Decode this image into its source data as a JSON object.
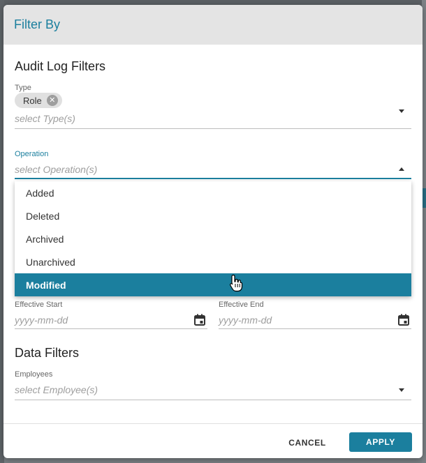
{
  "modal": {
    "title": "Filter By"
  },
  "audit": {
    "section_title": "Audit Log Filters",
    "type": {
      "label": "Type",
      "chip": "Role",
      "placeholder": "select Type(s)"
    },
    "operation": {
      "label": "Operation",
      "placeholder": "select Operation(s)",
      "options": [
        "Added",
        "Deleted",
        "Archived",
        "Unarchived",
        "Modified"
      ],
      "highlighted": "Modified"
    },
    "effective_start": {
      "label": "Effective Start",
      "placeholder": "yyyy-mm-dd"
    },
    "effective_end": {
      "label": "Effective End",
      "placeholder": "yyyy-mm-dd"
    }
  },
  "data_filters": {
    "section_title": "Data Filters",
    "employees": {
      "label": "Employees",
      "placeholder": "select Employee(s)"
    }
  },
  "footer": {
    "cancel": "CANCEL",
    "apply": "APPLY"
  },
  "colors": {
    "accent": "#1b7f9e",
    "header_bg": "#e4e4e4"
  }
}
